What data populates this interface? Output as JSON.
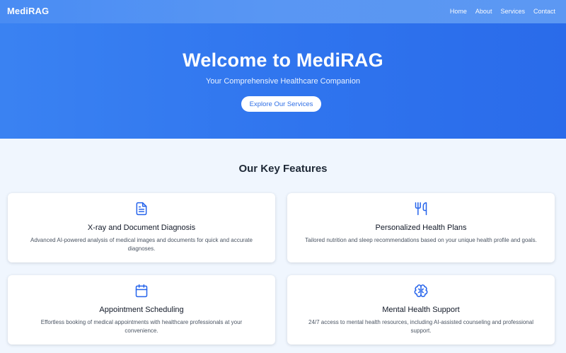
{
  "header": {
    "brand": "MediRAG",
    "nav": [
      "Home",
      "About",
      "Services",
      "Contact"
    ]
  },
  "hero": {
    "title": "Welcome to MediRAG",
    "subtitle": "Your Comprehensive Healthcare Companion",
    "cta": "Explore Our Services"
  },
  "features": {
    "heading": "Our Key Features",
    "items": [
      {
        "icon": "document-icon",
        "title": "X-ray and Document Diagnosis",
        "description": "Advanced AI-powered analysis of medical images and documents for quick and accurate diagnoses."
      },
      {
        "icon": "utensils-icon",
        "title": "Personalized Health Plans",
        "description": "Tailored nutrition and sleep recommendations based on your unique health profile and goals."
      },
      {
        "icon": "calendar-icon",
        "title": "Appointment Scheduling",
        "description": "Effortless booking of medical appointments with healthcare professionals at your convenience."
      },
      {
        "icon": "brain-icon",
        "title": "Mental Health Support",
        "description": "24/7 access to mental health resources, including AI-assisted counseling and professional support."
      }
    ]
  },
  "colors": {
    "primary": "#2f74ee",
    "accent": "#2563eb",
    "background": "#f0f6fe"
  }
}
